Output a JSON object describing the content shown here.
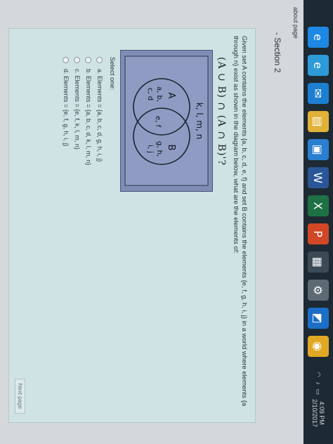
{
  "taskbar": {
    "icons": [
      {
        "name": "edge-icon",
        "color": "#1e88e5"
      },
      {
        "name": "explorer-icon",
        "color": "#2c9bd8"
      },
      {
        "name": "mail-icon",
        "color": "#1c7fd1"
      },
      {
        "name": "folder-icon",
        "color": "#e1b237"
      },
      {
        "name": "store-icon",
        "color": "#2a7fd0"
      },
      {
        "name": "word-icon",
        "color": "#2a5699"
      },
      {
        "name": "excel-icon",
        "color": "#1e7145"
      },
      {
        "name": "powerpoint-icon",
        "color": "#d24726"
      },
      {
        "name": "calculator-icon",
        "color": "#3b4a55"
      },
      {
        "name": "settings-icon",
        "color": "#5c6a73"
      },
      {
        "name": "photos-icon",
        "color": "#1c6fc6"
      },
      {
        "name": "chrome-icon",
        "color": "#e0a925"
      }
    ],
    "clock_time": "4:09 PM",
    "clock_date": "2/10/2017"
  },
  "page": {
    "footer_link": "about page",
    "section_title": "- Section 2",
    "question_text": "Given set A contains the elements {a, b, c, d, e, f} and set B contains the elements {e, f, g, h, i, j} in a world where elements {a through n} exist as shown in the diagram below, what are the elements of:",
    "formula": "(A ∪ B) ∩ (A ∩ B)'?",
    "diagram": {
      "universe_label": "k, l, m, n",
      "set_a_label": "A",
      "set_b_label": "B",
      "a_only": "a, b,\nc, d",
      "intersection": "e, f",
      "b_only": "g, h,\ni, j"
    },
    "select_one": "Select one:",
    "options": [
      "a. Elements = {a, b, c, d, g, h, i, j}",
      "b. Elements = {a, b, c, d, k, l, m, n}",
      "c. Elements = {e, f, k, l, m, n}",
      "d. Elements = {e, f, g, h, i, j}"
    ],
    "next_page": "Next page"
  }
}
